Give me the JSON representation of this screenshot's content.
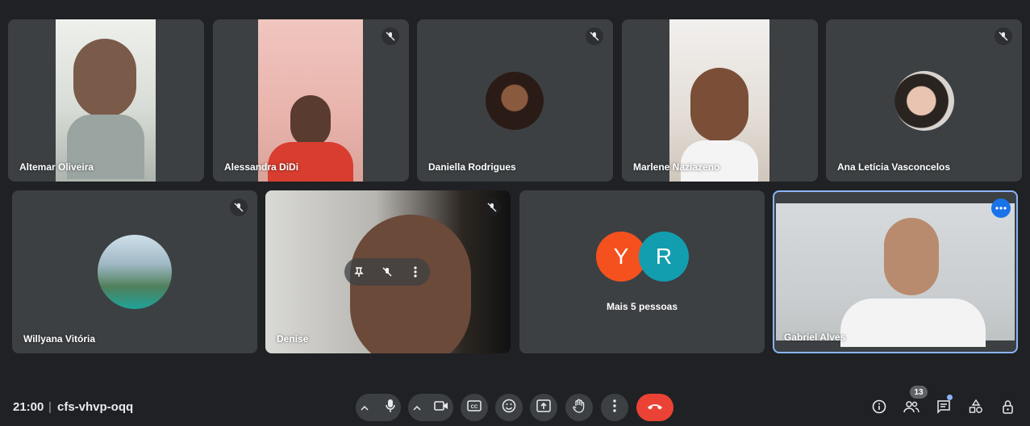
{
  "meeting": {
    "time": "21:00",
    "code": "cfs-vhvp-oqq"
  },
  "participants": [
    {
      "name": "Altemar Oliveira"
    },
    {
      "name": "Alessandra DiDi"
    },
    {
      "name": "Daniella Rodrigues"
    },
    {
      "name": "Marlene Naziazeno"
    },
    {
      "name": "Ana Letícia Vasconcelos"
    },
    {
      "name": "Willyana Vitória"
    },
    {
      "name": "Denise"
    },
    {
      "name": "Gabriel Alves"
    }
  ],
  "more_people": {
    "label": "Mais 5 pessoas",
    "avatars": [
      "Y",
      "R"
    ],
    "colors": [
      "#f4511e",
      "#129eaf"
    ]
  },
  "people_count": "13",
  "colors": {
    "background": "#202124",
    "tile": "#3c4043",
    "accent": "#8ab4f8",
    "end_call": "#ea4335"
  },
  "icons": [
    "mic-off-icon",
    "chevron-up-icon",
    "mic-icon",
    "camera-icon",
    "captions-icon",
    "emoji-icon",
    "present-icon",
    "raise-hand-icon",
    "more-vert-icon",
    "end-call-icon",
    "info-icon",
    "people-icon",
    "chat-icon",
    "activities-icon",
    "host-controls-icon",
    "pin-icon",
    "more-horiz-icon"
  ]
}
